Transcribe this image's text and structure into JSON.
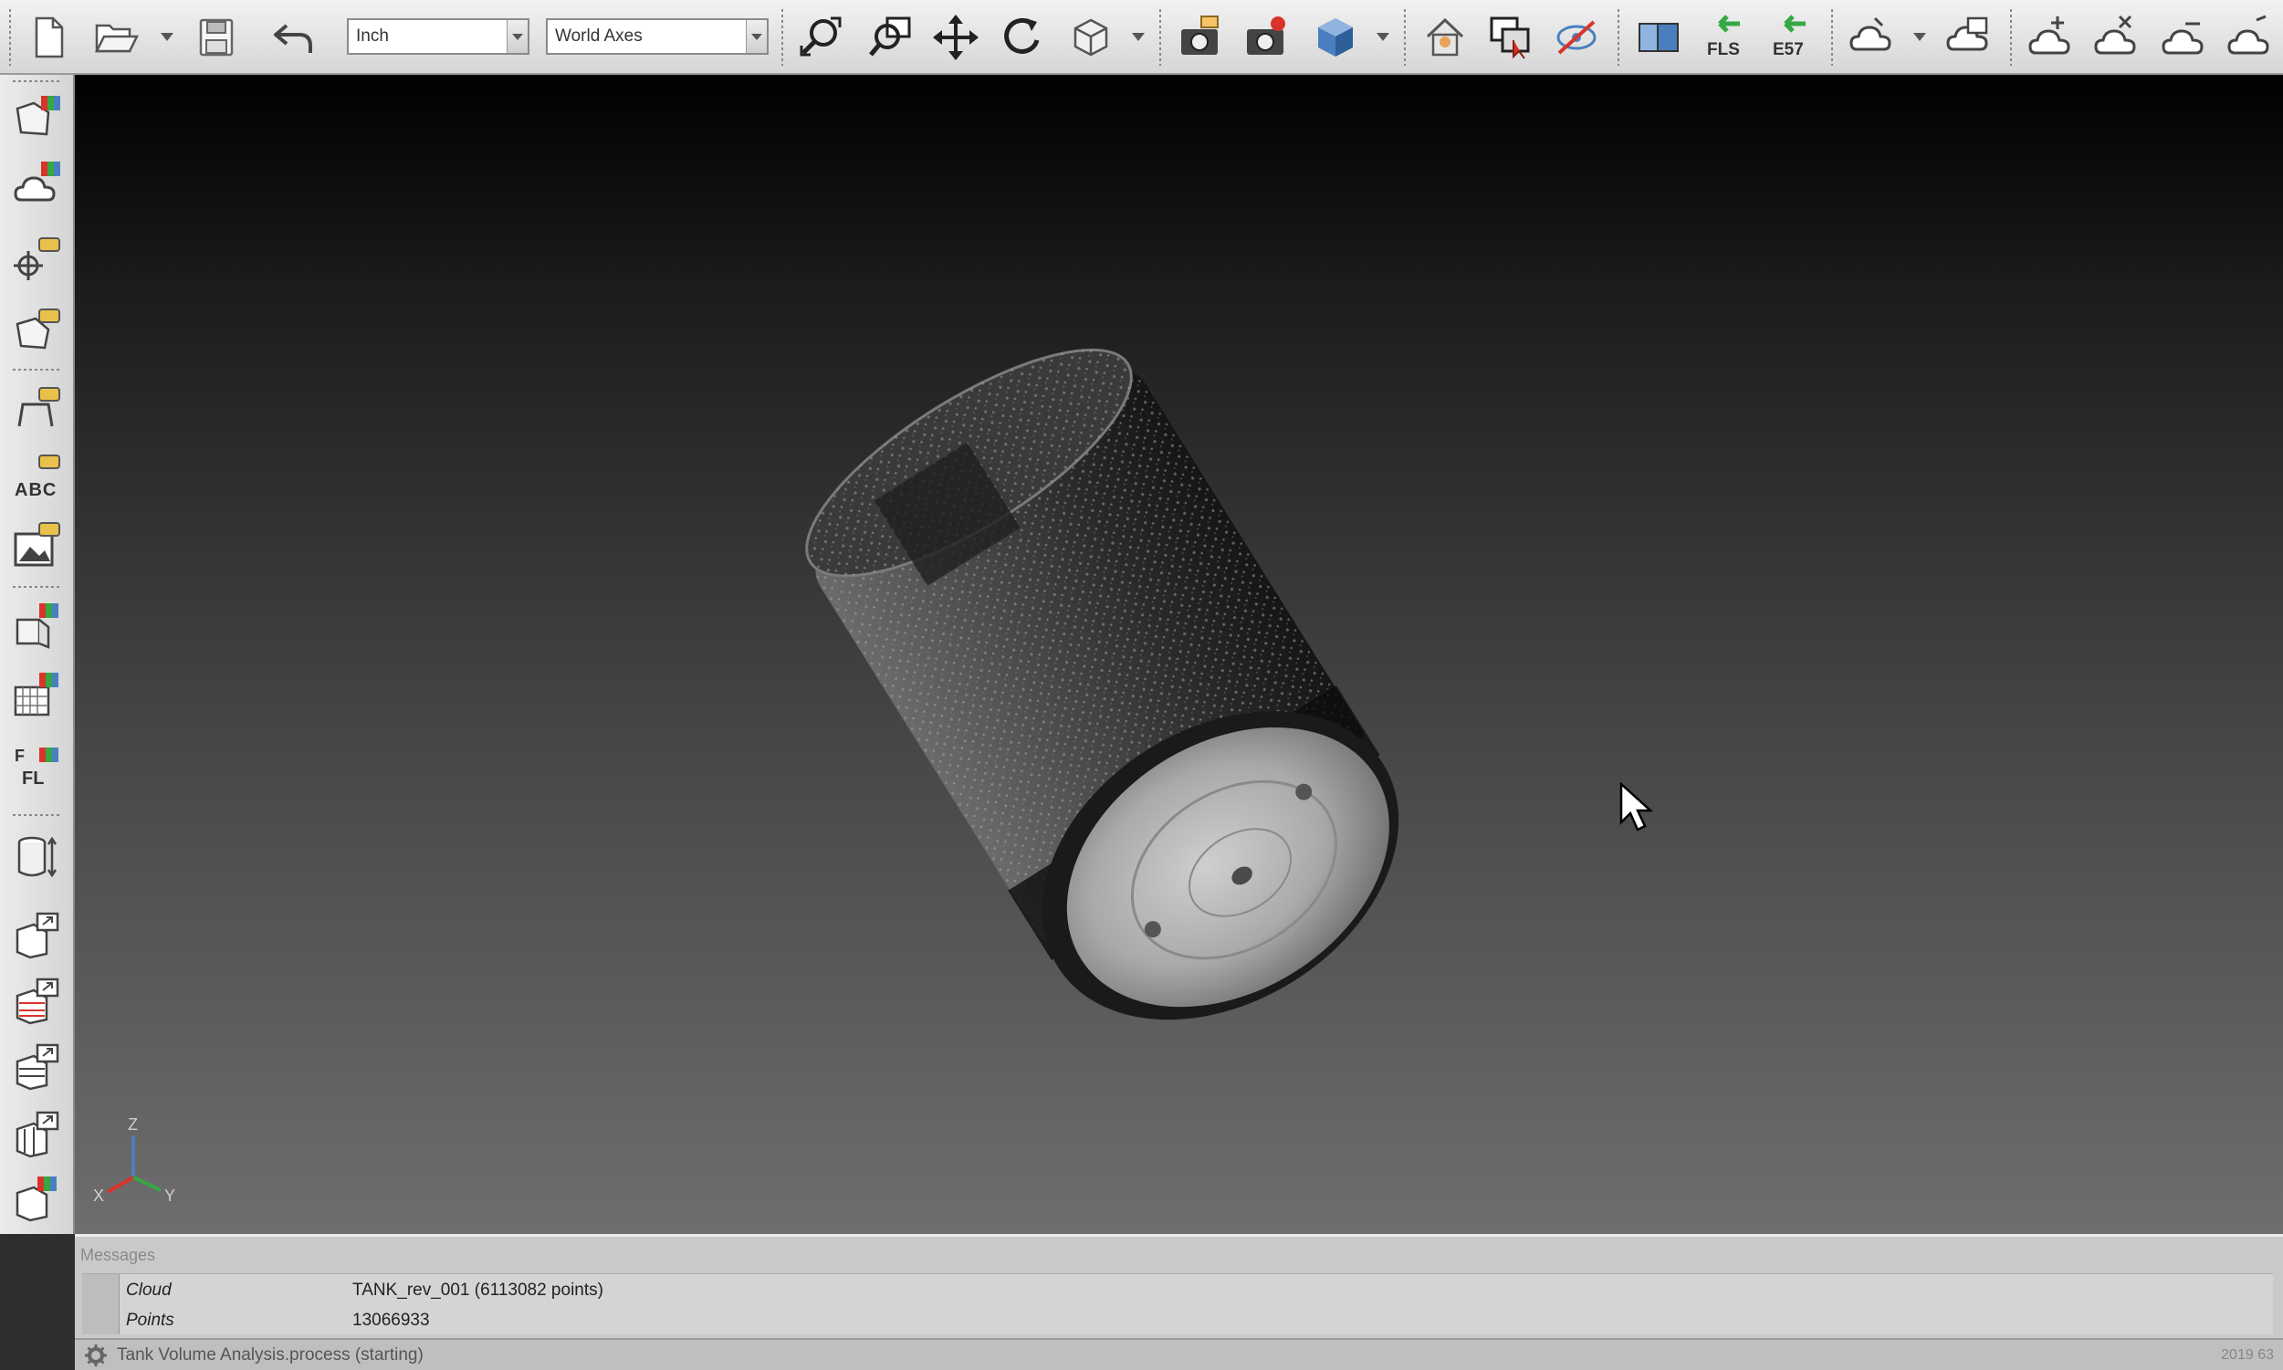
{
  "toolbar": {
    "units_value": "Inch",
    "axes_value": "World Axes",
    "fls_label": "FLS",
    "e57_label": "E57"
  },
  "left_toolbar": {
    "abc_label": "ABC",
    "ffl_label_top": "F",
    "ffl_label_bottom": "FL"
  },
  "viewport": {
    "axis_z": "Z",
    "axis_x": "X",
    "axis_y": "Y"
  },
  "messages": {
    "title": "Messages",
    "rows": [
      {
        "key": "Cloud",
        "value": "TANK_rev_001 (6113082 points)"
      },
      {
        "key": "Points",
        "value": "13066933"
      }
    ]
  },
  "status": {
    "text": "Tank Volume Analysis.process (starting)",
    "right_text": "2019 63"
  },
  "colors": {
    "accent_green": "#35a845",
    "accent_red": "#d9342b",
    "accent_blue": "#4a7fbf",
    "accent_yellow": "#e8c14a"
  }
}
